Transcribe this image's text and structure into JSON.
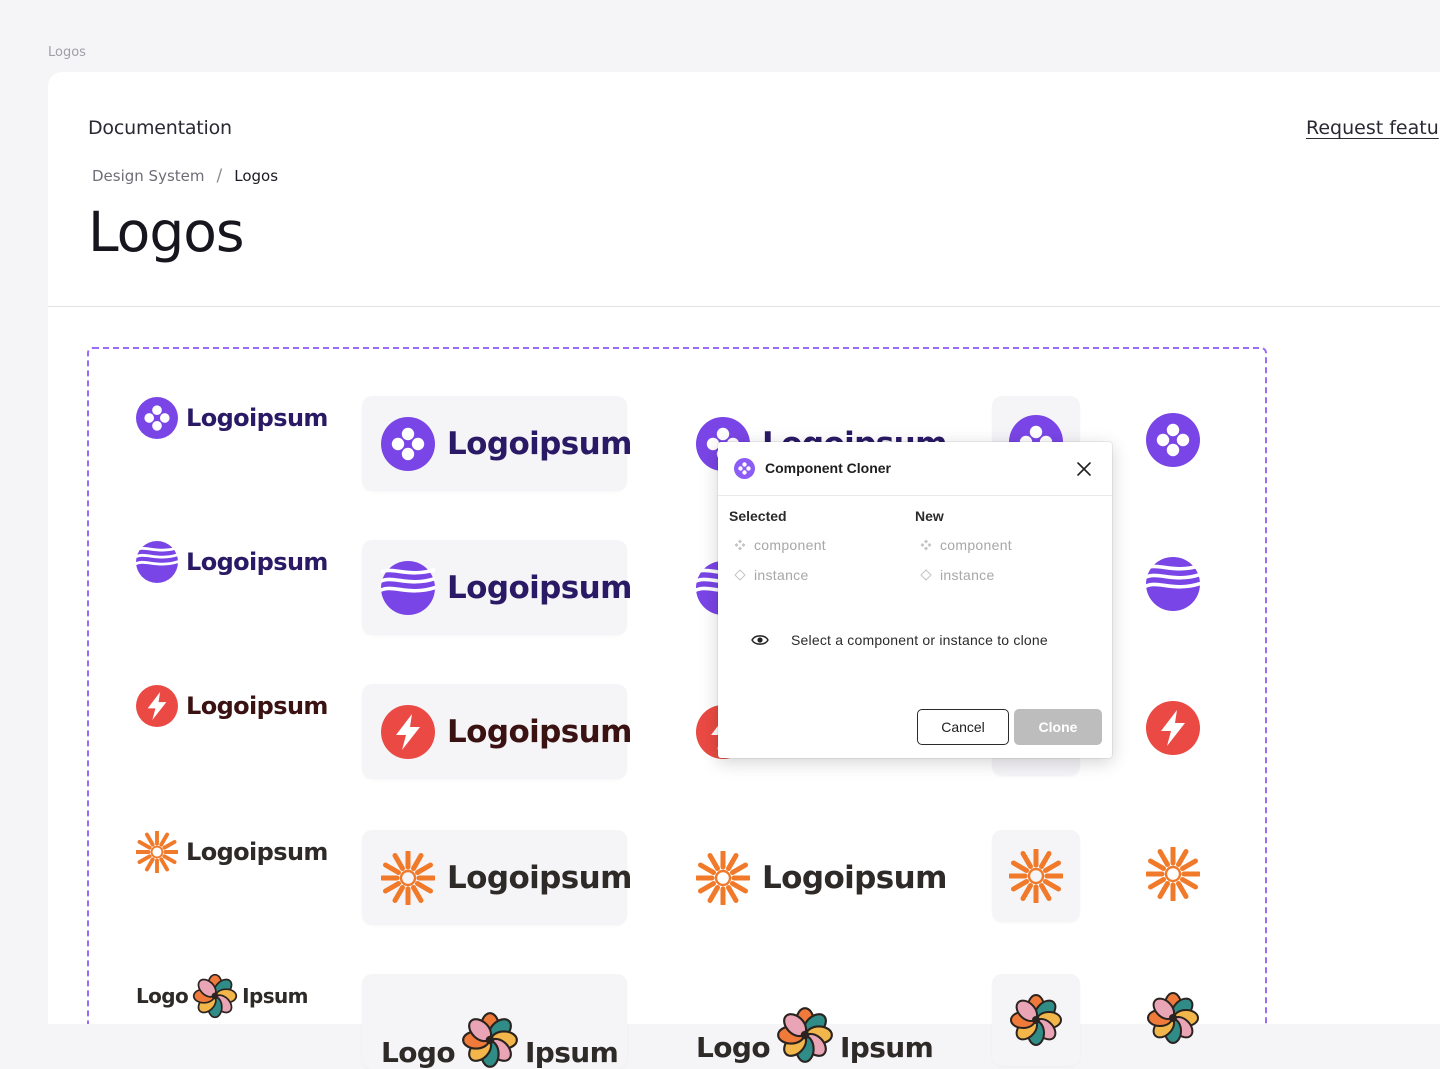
{
  "canvas": {
    "frame_label": "Logos"
  },
  "header": {
    "doc_link": "Documentation",
    "request_link": "Request featu",
    "breadcrumb": {
      "parent": "Design System",
      "separator": "/",
      "current": "Logos"
    },
    "title": "Logos"
  },
  "logos": {
    "wordmark": "Logoipsum",
    "flower_left": "Logo",
    "flower_right": "Ipsum",
    "colors": {
      "purple": "#7a45e6",
      "wave": "#7a45e6",
      "red": "#ea4a43",
      "orange": "#f07a2a",
      "text_purple": "#2a1a66",
      "text_red": "#3a1212",
      "text_dark": "#2d2a28"
    }
  },
  "dialog": {
    "title": "Component Cloner",
    "icon": "component-cloner-icon",
    "selected_header": "Selected",
    "new_header": "New",
    "option_component": "component",
    "option_instance": "instance",
    "hint": "Select a component or instance to clone",
    "cancel": "Cancel",
    "clone": "Clone"
  }
}
